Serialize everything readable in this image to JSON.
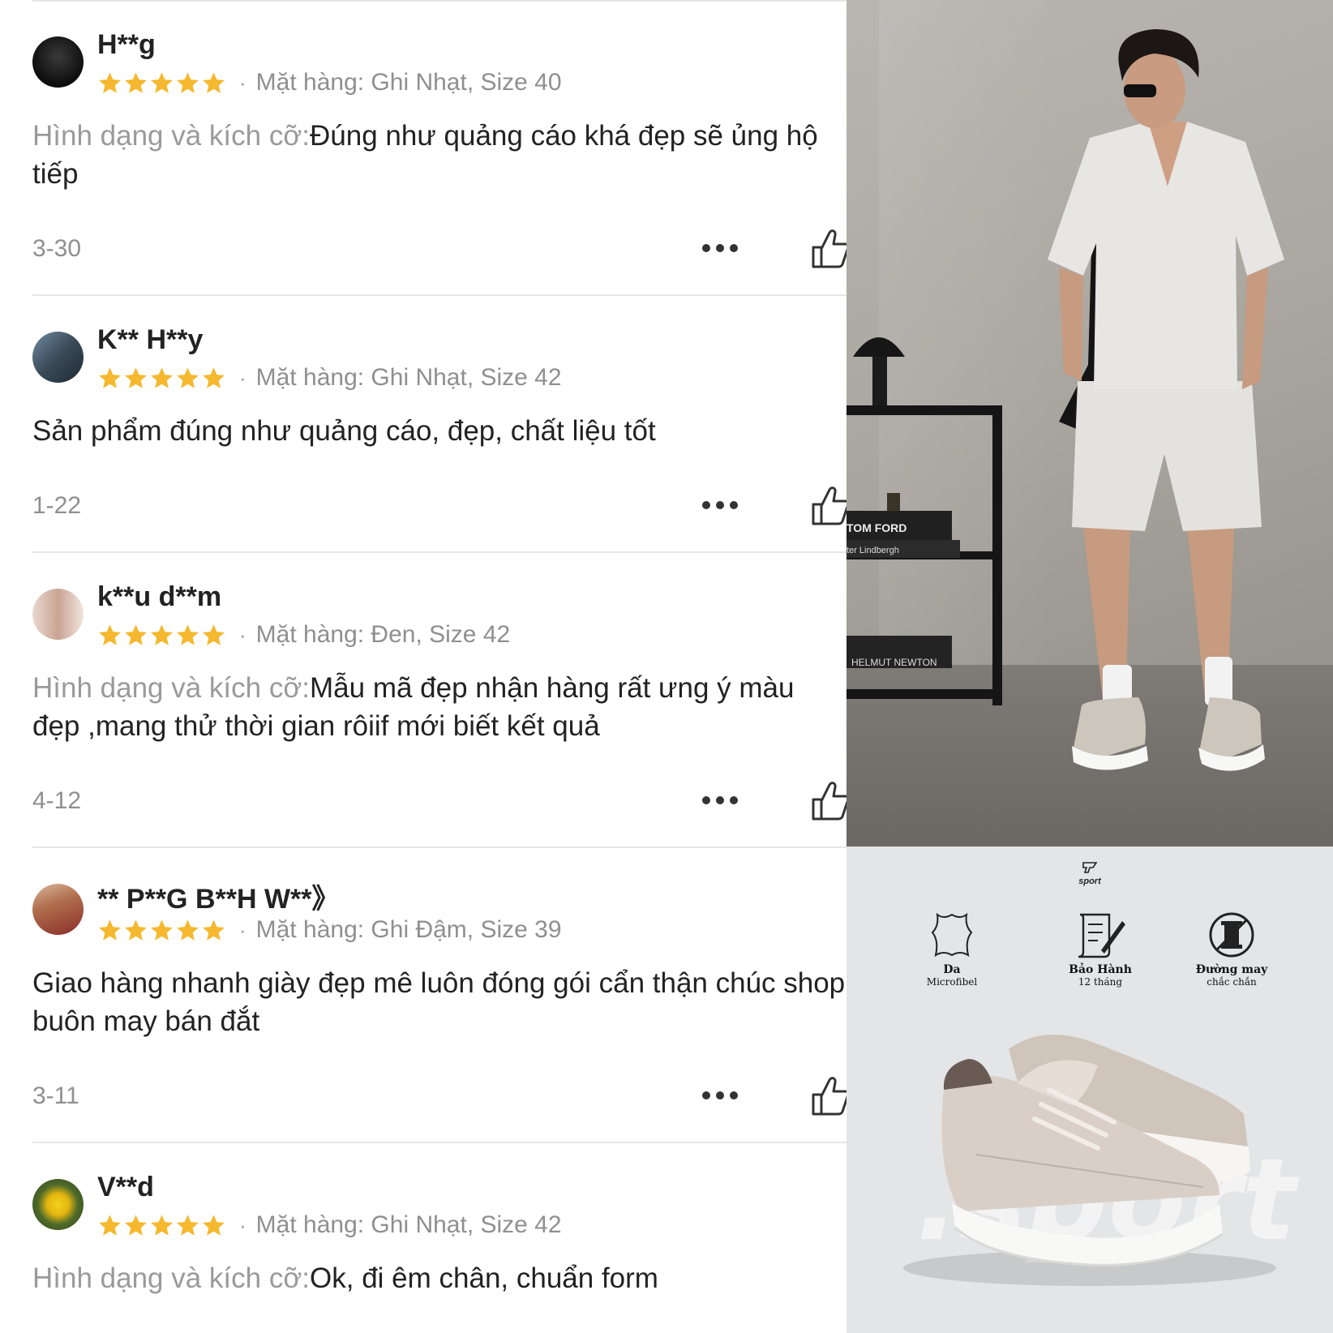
{
  "reviews": [
    {
      "user": "H**g",
      "rating": 5,
      "variant": "Mặt hàng: Ghi Nhạt, Size 40",
      "label": "Hình dạng và kích cỡ:",
      "text": "Đúng như quảng cáo khá đẹp sẽ ủng hộ tiếp",
      "date": "3-30"
    },
    {
      "user": "K** H**y",
      "rating": 5,
      "variant": "Mặt hàng: Ghi Nhạt, Size 42",
      "label": "",
      "text": "Sản phẩm đúng như quảng cáo, đẹp, chất liệu tốt",
      "date": "1-22"
    },
    {
      "user": "k**u d**m",
      "rating": 5,
      "variant": "Mặt hàng: Đen, Size 42",
      "label": "Hình dạng và kích cỡ:",
      "text": "Mẫu mã đẹp nhận hàng rất ưng ý màu đẹp ,mang thử thời gian rôiif mới biết kết quả",
      "date": "4-12"
    },
    {
      "user": "** P**G B**H W**》",
      "rating": 5,
      "variant": "Mặt hàng: Ghi Đậm, Size 39",
      "label": "",
      "text": "Giao hàng nhanh giày đẹp mê luôn đóng gói cẩn thận chúc shop buôn may bán đắt",
      "date": "3-11"
    },
    {
      "user": "V**d",
      "rating": 5,
      "variant": "Mặt hàng: Ghi Nhạt, Size 42",
      "label": "Hình dạng và kích cỡ:",
      "text": "Ok, đi êm chân, chuẩn form",
      "date": ""
    }
  ],
  "photo": {
    "book1": "TOM FORD",
    "book2": "ter Lindbergh",
    "book3": "HELMUT NEWTON"
  },
  "promo": {
    "logo": "sport",
    "features": [
      {
        "title": "Da",
        "subtitle": "Microfibel",
        "icon": "leather-icon"
      },
      {
        "title": "Bảo Hành",
        "subtitle": "12 tháng",
        "icon": "warranty-scroll-icon"
      },
      {
        "title": "Đường may",
        "subtitle": "chắc chắn",
        "icon": "thread-spool-icon"
      }
    ],
    "watermark": ".sport"
  },
  "colors": {
    "star": "#F5B82E",
    "text": "#222222",
    "muted": "#8F8F8F",
    "divider": "#E6E6E6",
    "promo_bg": "#E4E5E6"
  }
}
